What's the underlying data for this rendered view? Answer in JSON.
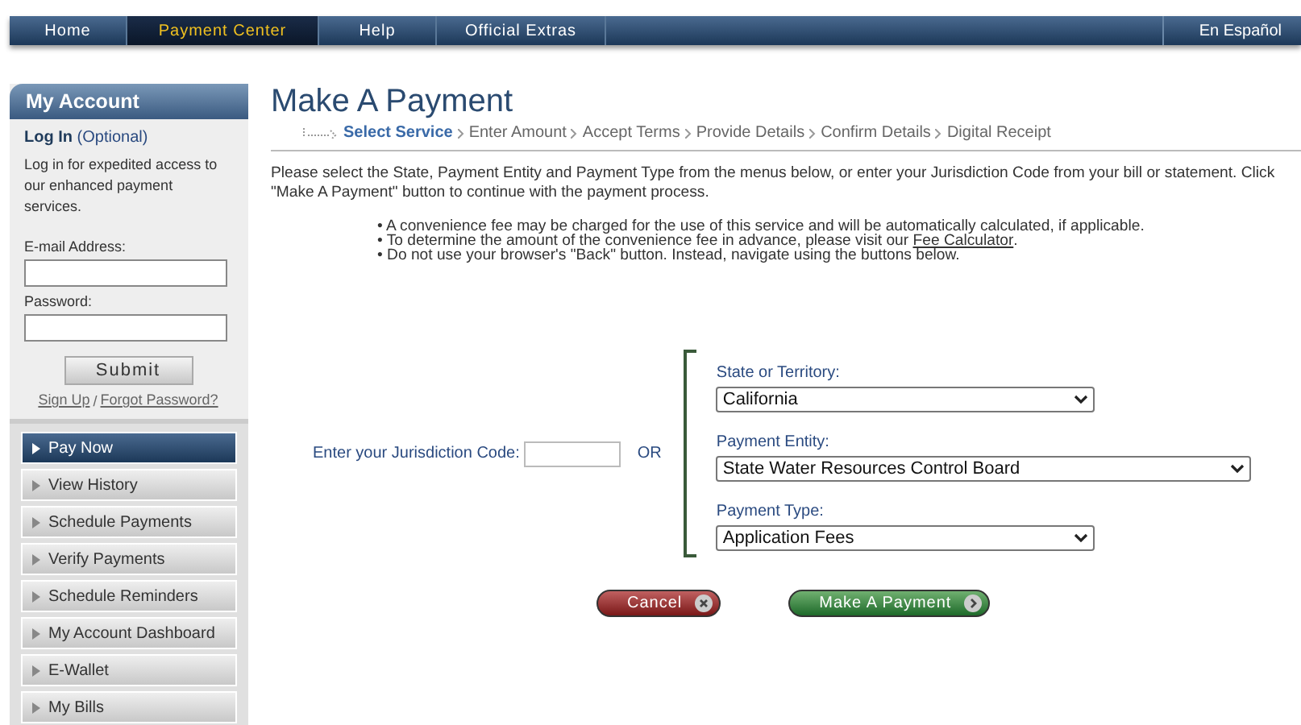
{
  "nav": {
    "items": [
      {
        "label": "Home",
        "selected": false
      },
      {
        "label": "Payment Center",
        "selected": true
      },
      {
        "label": "Help",
        "selected": false
      },
      {
        "label": "Official Extras",
        "selected": false
      }
    ],
    "language": "En Español"
  },
  "sidebar": {
    "title": "My Account",
    "login_title": "Log In",
    "login_note": "(Optional)",
    "description": "Log in for expedited access to our enhanced payment services.",
    "email_label": "E-mail Address:",
    "password_label": "Password:",
    "submit": "Submit",
    "sign_up": "Sign Up",
    "separator": "/",
    "forgot": "Forgot Password?",
    "menu": [
      {
        "label": "Pay Now",
        "selected": true
      },
      {
        "label": "View History",
        "selected": false
      },
      {
        "label": "Schedule Payments",
        "selected": false
      },
      {
        "label": "Verify Payments",
        "selected": false
      },
      {
        "label": "Schedule Reminders",
        "selected": false
      },
      {
        "label": "My Account Dashboard",
        "selected": false
      },
      {
        "label": "E-Wallet",
        "selected": false
      },
      {
        "label": "My Bills",
        "selected": false
      }
    ]
  },
  "page": {
    "title": "Make A Payment",
    "steps": [
      {
        "label": "Select Service",
        "selected": true
      },
      {
        "label": "Enter Amount",
        "selected": false
      },
      {
        "label": "Accept Terms",
        "selected": false
      },
      {
        "label": "Provide Details",
        "selected": false
      },
      {
        "label": "Confirm Details",
        "selected": false
      },
      {
        "label": "Digital Receipt",
        "selected": false
      }
    ],
    "intro": "Please select the State, Payment Entity and Payment Type from the menus below, or enter your Jurisdiction Code from your bill or statement. Click \"Make A Payment\" button to continue with the payment process.",
    "bullets": [
      {
        "text": "• A convenience fee may be charged for the use of this service and will be automatically calculated, if applicable."
      },
      {
        "text": "• To determine the amount of the convenience fee in advance, please visit our",
        "link": "Fee Calculator",
        "after": "."
      },
      {
        "text": "• Do not use your browser's \"Back\" button. Instead, navigate using the buttons below."
      }
    ],
    "jurisdiction_label": "Enter your Jurisdiction Code:",
    "or": "OR",
    "selects": [
      {
        "label": "State or Territory:",
        "value": "California",
        "wide": false
      },
      {
        "label": "Payment Entity:",
        "value": "State Water Resources Control Board",
        "wide": true
      },
      {
        "label": "Payment Type:",
        "value": "Application Fees",
        "wide": false
      }
    ],
    "buttons": [
      {
        "label": "Cancel",
        "kind": "cancel"
      },
      {
        "label": "Make A Payment",
        "kind": "submit"
      }
    ]
  }
}
